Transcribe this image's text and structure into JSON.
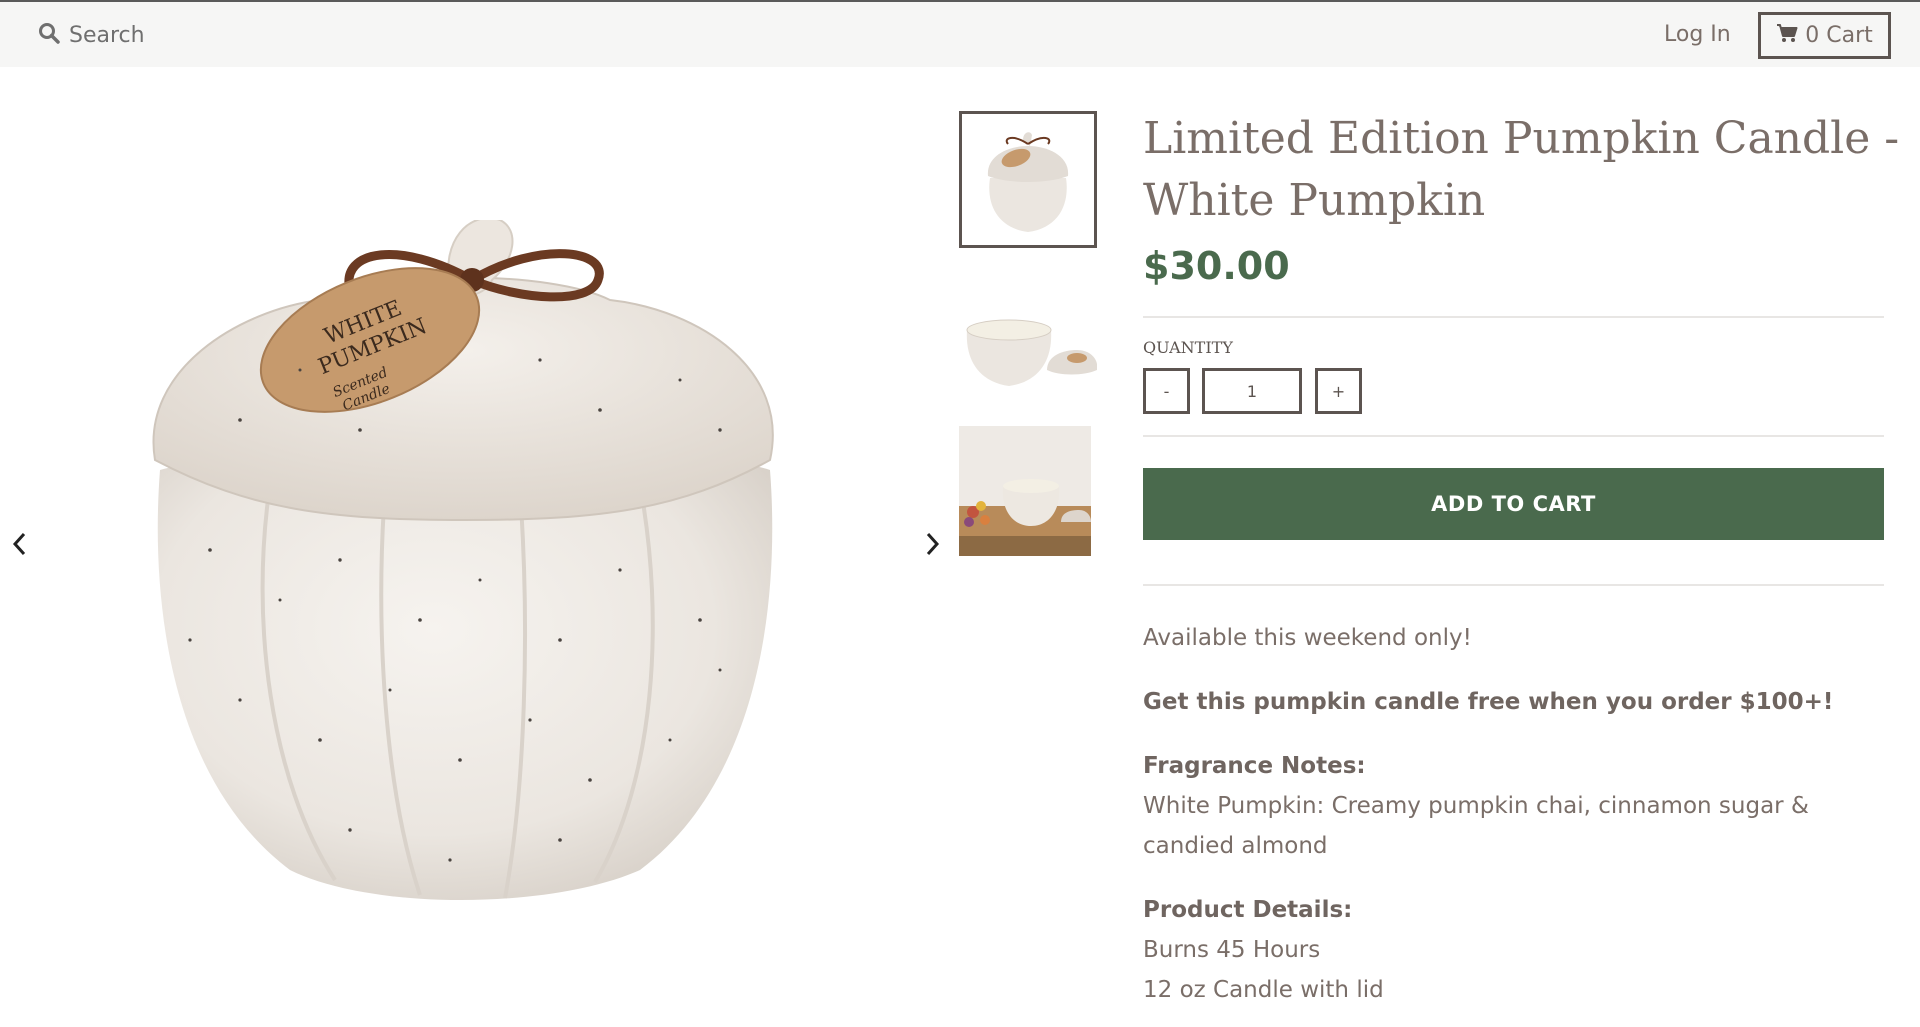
{
  "header": {
    "search_label": "Search",
    "login_label": "Log In",
    "cart_label": "0 Cart"
  },
  "product": {
    "title": "Limited Edition Pumpkin Candle - White Pumpkin",
    "price": "$30.00",
    "quantity_label": "QUANTITY",
    "quantity_minus": "-",
    "quantity_plus": "+",
    "quantity_value": "1",
    "add_to_cart": "ADD TO CART",
    "availability": "Available this weekend only!",
    "promo": "Get this pumpkin candle free when you order $100+!",
    "fragrance_heading": "Fragrance Notes:",
    "fragrance_text": "White Pumpkin: Creamy pumpkin chai, cinnamon sugar & candied almond",
    "details_heading": "Product Details:",
    "details": [
      "Burns 45 Hours",
      "12 oz Candle with lid"
    ],
    "label_text": [
      "WHITE",
      "PUMPKIN",
      "Scented",
      "Candle"
    ]
  },
  "colors": {
    "accent_green": "#4a6a4d",
    "text_brown": "#7a6e68",
    "border_dark": "#5c5450",
    "topbar_bg": "#f6f6f5"
  },
  "icons": {
    "search": "search-icon",
    "cart": "cart-icon",
    "prev": "chevron-left-icon",
    "next": "chevron-right-icon"
  }
}
